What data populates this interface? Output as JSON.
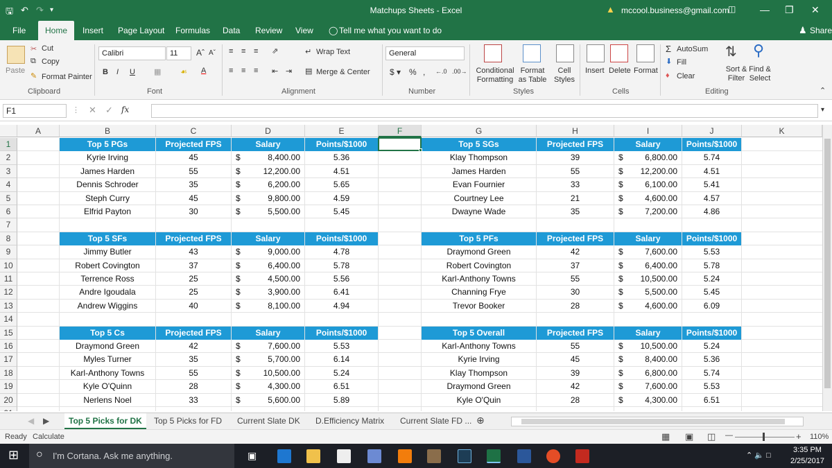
{
  "titlebar": {
    "title": "Matchups Sheets  -  Excel",
    "account": "mccool.business@gmail.com"
  },
  "tabs": [
    "File",
    "Home",
    "Insert",
    "Page Layout",
    "Formulas",
    "Data",
    "Review",
    "View"
  ],
  "tell_me": "Tell me what you want to do",
  "share": "Share",
  "ribbon": {
    "cut": "Cut",
    "copy": "Copy",
    "format_painter": "Format Painter",
    "paste": "Paste",
    "font_name": "Calibri",
    "font_size": "11",
    "wrap_text": "Wrap Text",
    "merge_center": "Merge & Center",
    "number_format": "General",
    "conditional_formatting": "Conditional Formatting",
    "format_as_table": "Format as Table",
    "cell_styles": "Cell Styles",
    "insert": "Insert",
    "delete": "Delete",
    "format": "Format",
    "autosum": "AutoSum",
    "fill": "Fill",
    "clear": "Clear",
    "sort_filter": "Sort & Filter",
    "find_select": "Find & Select",
    "groups": {
      "clipboard": "Clipboard",
      "font": "Font",
      "alignment": "Alignment",
      "number": "Number",
      "styles": "Styles",
      "cells": "Cells",
      "editing": "Editing"
    }
  },
  "formula_bar": {
    "name_box": "F1",
    "fx": "fx",
    "content": ""
  },
  "columns": [
    "A",
    "B",
    "C",
    "D",
    "E",
    "F",
    "G",
    "H",
    "I",
    "J",
    "K"
  ],
  "rows": [
    "1",
    "2",
    "3",
    "4",
    "5",
    "6",
    "7",
    "8",
    "9",
    "10",
    "11",
    "12",
    "13",
    "14",
    "15",
    "16",
    "17",
    "18",
    "19",
    "20",
    "21"
  ],
  "tables": {
    "header_cols": [
      "Projected FPS",
      "Salary",
      "Points/$1000"
    ],
    "left": [
      {
        "title": "Top 5 PGs",
        "rows": [
          [
            "Kyrie Irving",
            "45",
            "8,400.00",
            "5.36"
          ],
          [
            "James Harden",
            "55",
            "12,200.00",
            "4.51"
          ],
          [
            "Dennis Schroder",
            "35",
            "6,200.00",
            "5.65"
          ],
          [
            "Steph Curry",
            "45",
            "9,800.00",
            "4.59"
          ],
          [
            "Elfrid Payton",
            "30",
            "5,500.00",
            "5.45"
          ]
        ]
      },
      {
        "title": "Top 5 SFs",
        "rows": [
          [
            "Jimmy Butler",
            "43",
            "9,000.00",
            "4.78"
          ],
          [
            "Robert Covington",
            "37",
            "6,400.00",
            "5.78"
          ],
          [
            "Terrence Ross",
            "25",
            "4,500.00",
            "5.56"
          ],
          [
            "Andre Igoudala",
            "25",
            "3,900.00",
            "6.41"
          ],
          [
            "Andrew Wiggins",
            "40",
            "8,100.00",
            "4.94"
          ]
        ]
      },
      {
        "title": "Top 5 Cs",
        "rows": [
          [
            "Draymond Green",
            "42",
            "7,600.00",
            "5.53"
          ],
          [
            "Myles Turner",
            "35",
            "5,700.00",
            "6.14"
          ],
          [
            "Karl-Anthony Towns",
            "55",
            "10,500.00",
            "5.24"
          ],
          [
            "Kyle O'Quinn",
            "28",
            "4,300.00",
            "6.51"
          ],
          [
            "Nerlens Noel",
            "33",
            "5,600.00",
            "5.89"
          ]
        ]
      }
    ],
    "right": [
      {
        "title": "Top 5 SGs",
        "rows": [
          [
            "Klay Thompson",
            "39",
            "6,800.00",
            "5.74"
          ],
          [
            "James Harden",
            "55",
            "12,200.00",
            "4.51"
          ],
          [
            "Evan Fournier",
            "33",
            "6,100.00",
            "5.41"
          ],
          [
            "Courtney Lee",
            "21",
            "4,600.00",
            "4.57"
          ],
          [
            "Dwayne Wade",
            "35",
            "7,200.00",
            "4.86"
          ]
        ]
      },
      {
        "title": "Top 5 PFs",
        "rows": [
          [
            "Draymond Green",
            "42",
            "7,600.00",
            "5.53"
          ],
          [
            "Robert Covington",
            "37",
            "6,400.00",
            "5.78"
          ],
          [
            "Karl-Anthony Towns",
            "55",
            "10,500.00",
            "5.24"
          ],
          [
            "Channing Frye",
            "30",
            "5,500.00",
            "5.45"
          ],
          [
            "Trevor Booker",
            "28",
            "4,600.00",
            "6.09"
          ]
        ]
      },
      {
        "title": "Top 5 Overall",
        "rows": [
          [
            "Karl-Anthony Towns",
            "55",
            "10,500.00",
            "5.24"
          ],
          [
            "Kyrie Irving",
            "45",
            "8,400.00",
            "5.36"
          ],
          [
            "Klay Thompson",
            "39",
            "6,800.00",
            "5.74"
          ],
          [
            "Draymond Green",
            "42",
            "7,600.00",
            "5.53"
          ],
          [
            "Kyle O'Quin",
            "28",
            "4,300.00",
            "6.51"
          ]
        ]
      }
    ],
    "currency": "$",
    "header_color": "#1e9ad6"
  },
  "sheet_tabs": [
    "Top 5 Picks for DK",
    "Top 5 Picks for FD",
    "Current Slate DK",
    "D.Efficiency Matrix",
    "Current Slate FD ..."
  ],
  "active_sheet": "Top 5 Picks for DK",
  "status": {
    "ready": "Ready",
    "calculate": "Calculate",
    "zoom": "110%"
  },
  "taskbar": {
    "cortana": "I'm Cortana. Ask me anything.",
    "time": "3:35 PM",
    "date": "2/25/2017"
  },
  "accent_color": "#217346"
}
